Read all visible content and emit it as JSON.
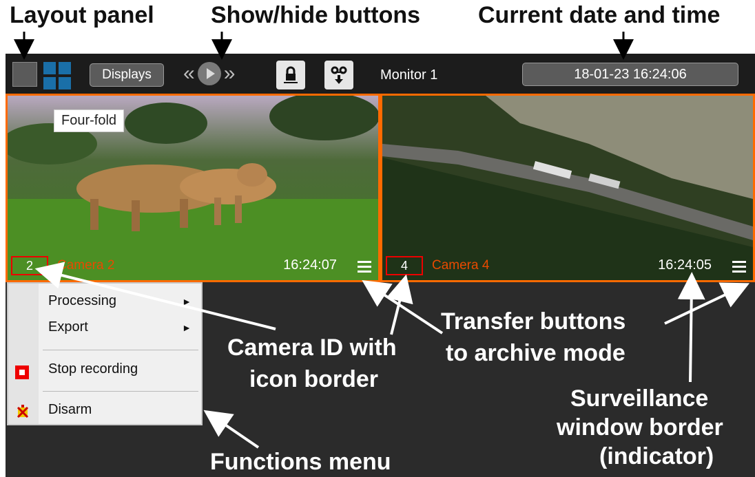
{
  "annotations": {
    "layout_panel": "Layout panel",
    "show_hide": "Show/hide buttons",
    "current_datetime": "Current date and time",
    "transfer_line1": "Transfer buttons",
    "transfer_line2": "to archive mode",
    "camera_id_line1": "Camera ID with",
    "camera_id_line2": "icon border",
    "surveillance_line1": "Surveillance",
    "surveillance_line2": "window border",
    "surveillance_line3": "(indicator)",
    "functions_menu": "Functions menu"
  },
  "toolbar": {
    "displays_label": "Displays",
    "prev_glyph": "«",
    "next_glyph": "»",
    "monitor_label": "Monitor 1",
    "datetime": "18-01-23 16:24:06"
  },
  "cameras": [
    {
      "id": "2",
      "name": "Camera 2",
      "time": "16:24:07",
      "overlay_label": "Four-fold"
    },
    {
      "id": "4",
      "name": "Camera 4",
      "time": "16:24:05"
    }
  ],
  "menu": {
    "items": [
      {
        "label": "Processing",
        "submenu": true
      },
      {
        "label": "Export",
        "submenu": true
      },
      {
        "label": "Stop recording",
        "icon": "stop-record-icon"
      },
      {
        "label": "Disarm",
        "icon": "disarm-icon"
      }
    ],
    "arrow_glyph": "►"
  },
  "colors": {
    "window_border": "#ff6a00",
    "camera_name": "#e84a00",
    "camera_id_border": "#ee0000",
    "layout_blue": "#1a6fa8"
  }
}
